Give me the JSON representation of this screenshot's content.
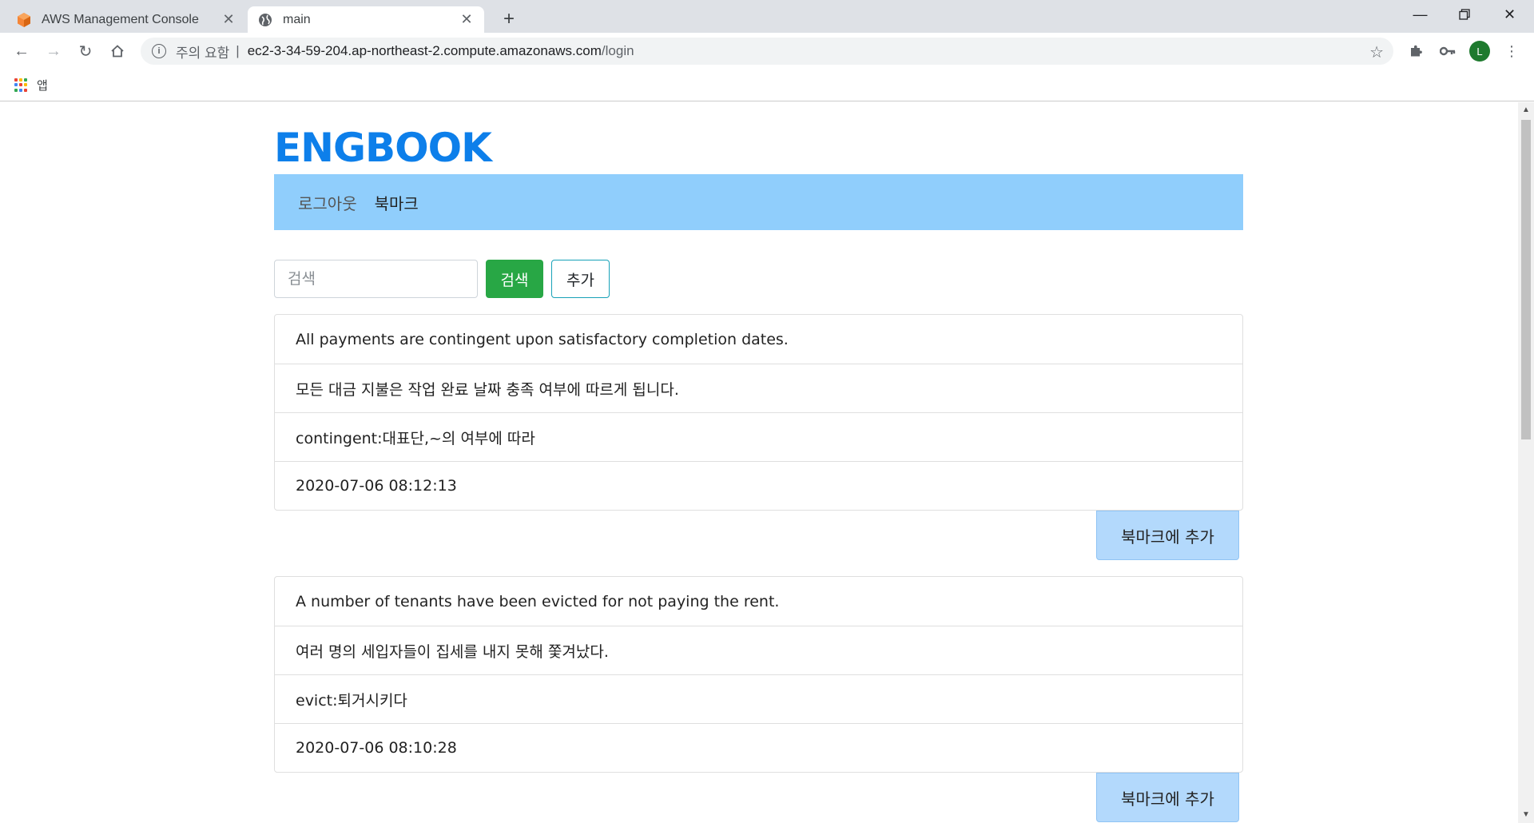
{
  "browser": {
    "tabs": [
      {
        "title": "AWS Management Console",
        "active": false,
        "icon": "aws-cube-icon"
      },
      {
        "title": "main",
        "active": true,
        "icon": "globe-icon"
      }
    ],
    "address": {
      "warning": "주의 요함",
      "separator": "|",
      "host": "ec2-3-34-59-204.ap-northeast-2.compute.amazonaws.com",
      "path": "/login"
    },
    "profile_initial": "L",
    "bookmarks_bar": {
      "apps_label": "앱"
    }
  },
  "page": {
    "brand": "ENGBOOK",
    "nav": {
      "logout": "로그아웃",
      "bookmark": "북마크"
    },
    "search": {
      "placeholder": "검색",
      "button": "검색",
      "add_button": "추가"
    },
    "bookmark_button": "북마크에 추가",
    "entries": [
      {
        "sentence": "All payments are contingent upon satisfactory completion dates.",
        "translation": "모든 대금 지불은 작업 완료 날짜 충족 여부에 따르게 됩니다.",
        "note": "contingent:대표단,~의 여부에 따라",
        "timestamp": "2020-07-06 08:12:13"
      },
      {
        "sentence": "A number of tenants have been evicted for not paying the rent.",
        "translation": "여러 명의 세입자들이 집세를 내지 못해 쫓겨났다.",
        "note": "evict:퇴거시키다",
        "timestamp": "2020-07-06 08:10:28"
      }
    ]
  },
  "colors": {
    "brand": "#0d7fea",
    "navbar": "#90cefc",
    "search_button": "#28a745",
    "add_border": "#17a2b8",
    "bookmark_button": "#b3d9fc"
  }
}
